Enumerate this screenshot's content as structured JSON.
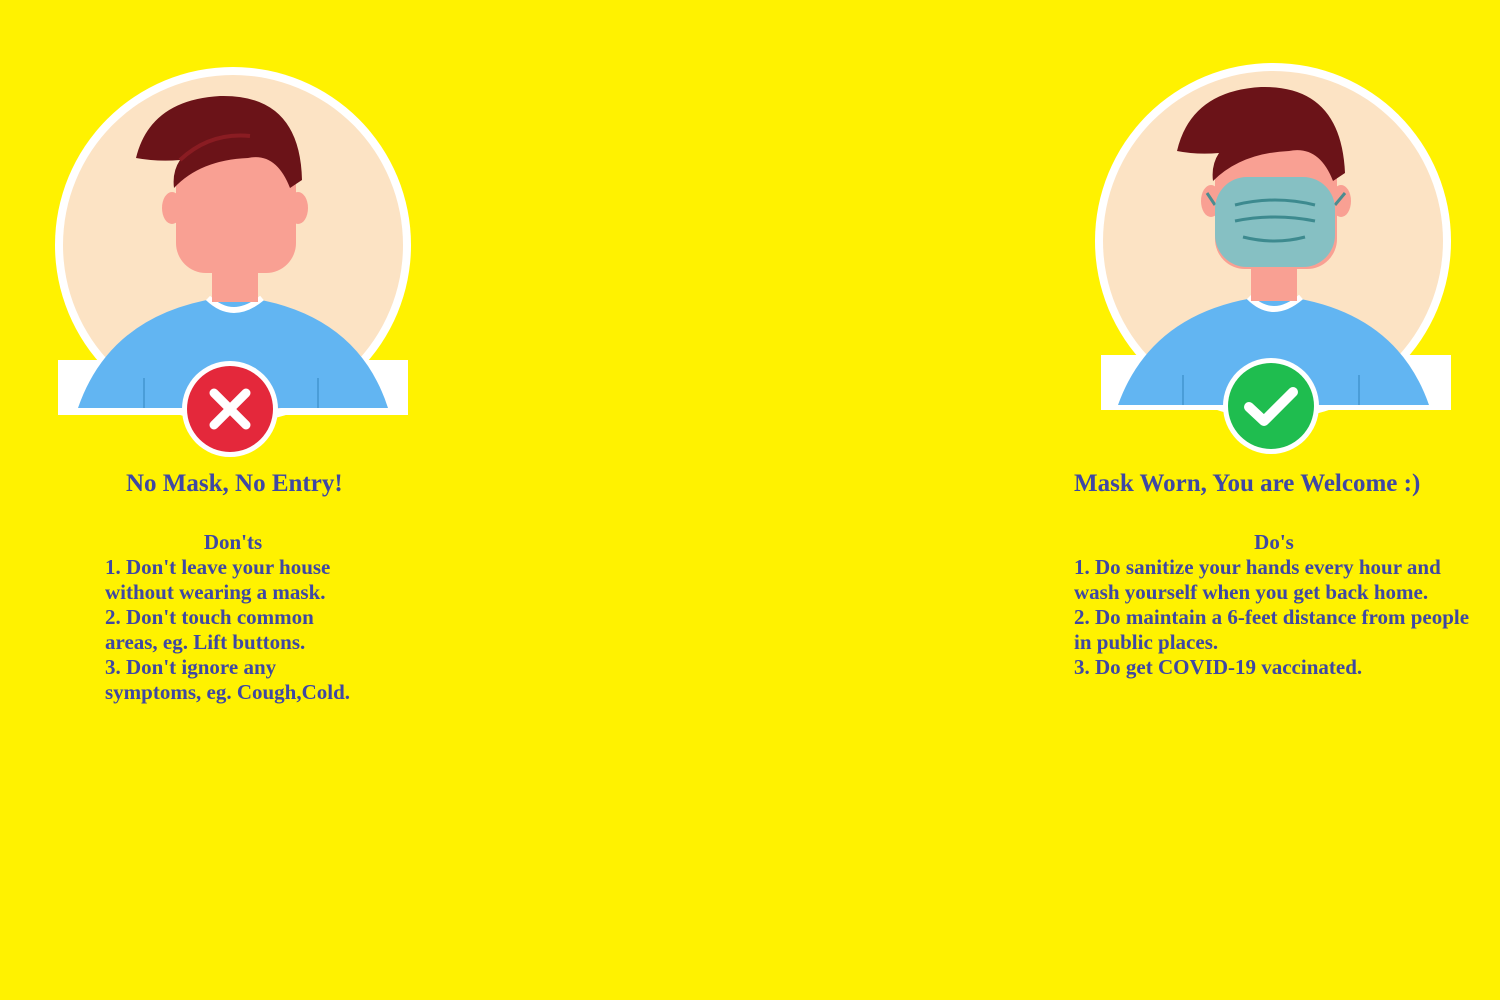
{
  "colors": {
    "background": "#fff200",
    "text": "#3f48a3",
    "hair": "#6b1318",
    "skin": "#f9a093",
    "circle": "#fce3c4",
    "shirt": "#62b5f2",
    "mask": "#86c0c3",
    "cross_badge": "#e4283b",
    "check_badge": "#1fbd4f"
  },
  "left_panel": {
    "avatar_icon": "person-without-mask-icon",
    "badge_icon": "cross-icon",
    "title": "No Mask, No Entry!",
    "heading": "Don'ts",
    "items": [
      "1. Don't leave your house without wearing a mask.",
      "2. Don't touch common areas, eg. Lift buttons.",
      "3. Don't ignore any symptoms, eg. Cough,Cold."
    ]
  },
  "right_panel": {
    "avatar_icon": "person-with-mask-icon",
    "badge_icon": "check-icon",
    "title": "Mask Worn, You are Welcome :)",
    "heading": "Do's",
    "items": [
      "1. Do sanitize your hands every hour and wash yourself when you get back home.",
      "2. Do maintain a 6-feet distance from people in public places.",
      "3. Do get COVID-19 vaccinated."
    ]
  }
}
